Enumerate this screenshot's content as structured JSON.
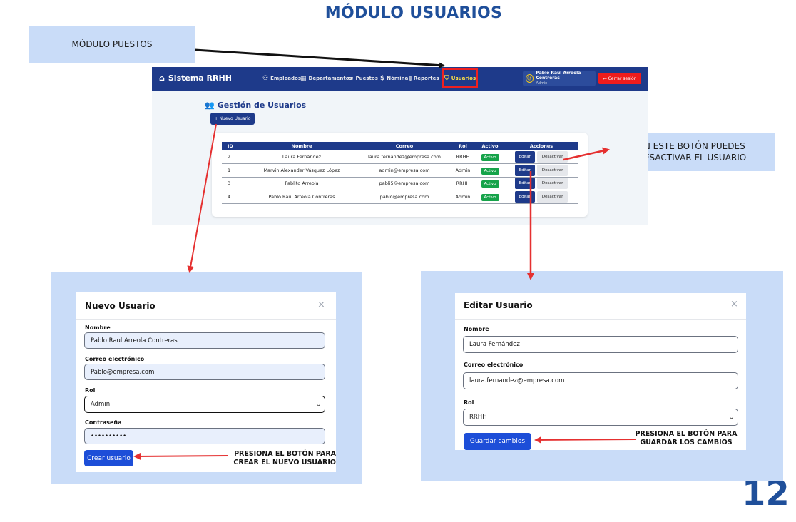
{
  "page": {
    "title": "MÓDULO USUARIOS",
    "number": "12",
    "colors": {
      "title": "#1f4f9a",
      "callout_bg": "#c9dcf8",
      "navbar": "#1e3a8a",
      "highlight": "#ef2020",
      "success": "#16a34a",
      "arrow_red": "#e53030"
    }
  },
  "callouts": {
    "puestos": "MÓDULO PUESTOS",
    "desactivar": "EN ESTE BOTÓN PUEDES DESACTIVAR EL USUARIO"
  },
  "app": {
    "brand": "Sistema RRHH",
    "brand_icon": "building-icon",
    "nav": [
      {
        "label": "Empleados",
        "icon": "users-icon"
      },
      {
        "label": "Departamentos",
        "icon": "building-icon"
      },
      {
        "label": "Puestos",
        "icon": "briefcase-icon"
      },
      {
        "label": "Nómina",
        "icon": "dollar-icon"
      },
      {
        "label": "Reportes",
        "icon": "bar-chart-icon"
      },
      {
        "label": "Usuarios",
        "icon": "shield-icon",
        "active": true
      }
    ],
    "user": {
      "name": "Pablo Raul Arreola Contreras",
      "role": "Admin"
    },
    "logout": "Cerrar sesión",
    "section_title": "Gestión de Usuarios",
    "new_user_button": "+ Nuevo Usuario",
    "table": {
      "headers": [
        "ID",
        "Nombre",
        "Correo",
        "Rol",
        "Activo",
        "Acciones"
      ],
      "rows": [
        {
          "id": "2",
          "nombre": "Laura Fernández",
          "correo": "laura.fernandez@empresa.com",
          "rol": "RRHH",
          "activo": "Activo"
        },
        {
          "id": "1",
          "nombre": "Marvin Alexander Vásquez López",
          "correo": "admin@empresa.com",
          "rol": "Admin",
          "activo": "Activo"
        },
        {
          "id": "3",
          "nombre": "Pablito Arreola",
          "correo": "pabli5@empresa.com",
          "rol": "RRHH",
          "activo": "Activo"
        },
        {
          "id": "4",
          "nombre": "Pablo Raul Arreola Contreras",
          "correo": "pablo@empresa.com",
          "rol": "Admin",
          "activo": "Activo"
        }
      ],
      "edit_label": "Editar",
      "deactivate_label": "Desactivar"
    }
  },
  "new_user_modal": {
    "title": "Nuevo Usuario",
    "close": "×",
    "fields": {
      "nombre": {
        "label": "Nombre",
        "value": "Pablo Raul Arreola Contreras"
      },
      "correo": {
        "label": "Correo electrónico",
        "value": "Pablo@empresa.com"
      },
      "rol": {
        "label": "Rol",
        "value": "Admin"
      },
      "password": {
        "label": "Contraseña",
        "value": "••••••••••"
      }
    },
    "submit": "Crear usuario",
    "instruction_line1": "PRESIONA EL BOTÓN PARA",
    "instruction_line2": "CREAR EL NUEVO USUARIO"
  },
  "edit_user_modal": {
    "title": "Editar Usuario",
    "close": "×",
    "fields": {
      "nombre": {
        "label": "Nombre",
        "value": "Laura Fernández"
      },
      "correo": {
        "label": "Correo electrónico",
        "value": "laura.fernandez@empresa.com"
      },
      "rol": {
        "label": "Rol",
        "value": "RRHH"
      }
    },
    "submit": "Guardar cambios",
    "instruction_line1": "PRESIONA EL BOTÓN PARA",
    "instruction_line2": "GUARDAR LOS CAMBIOS"
  }
}
